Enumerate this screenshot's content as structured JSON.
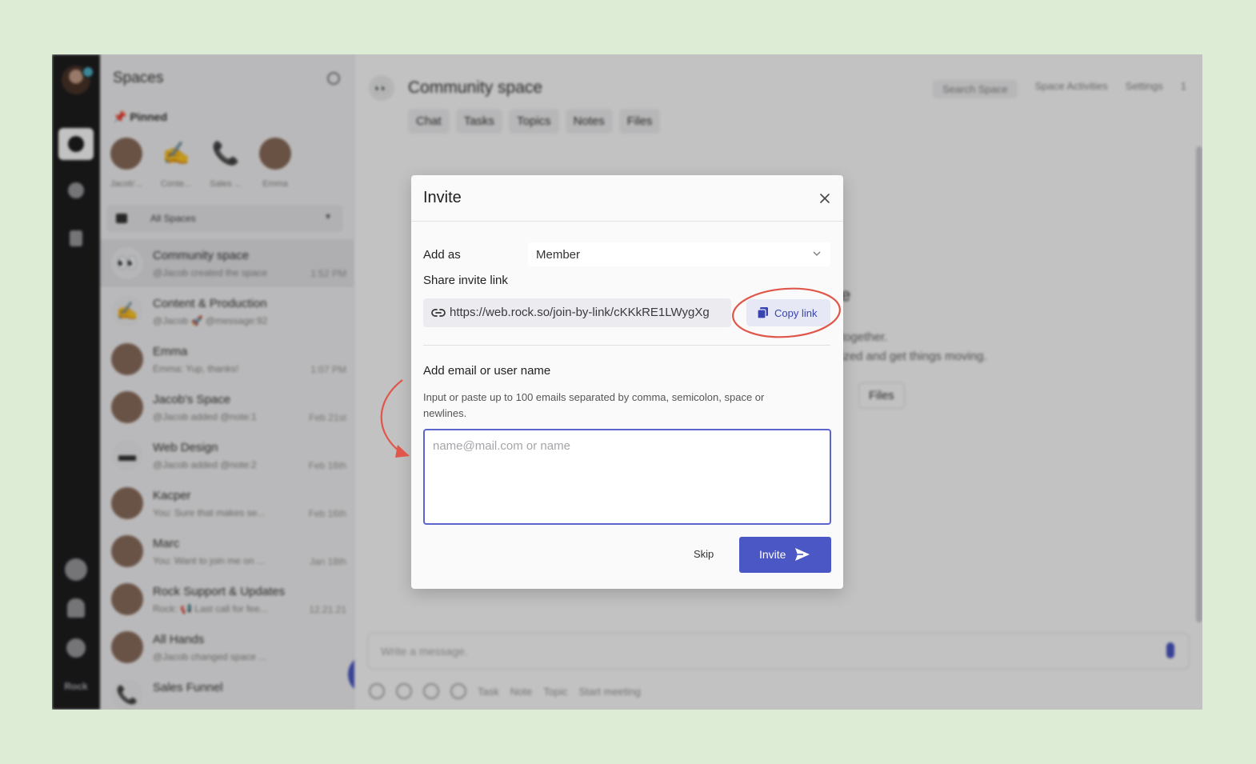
{
  "sidebar": {
    "title": "Spaces",
    "pinned_label": "Pinned",
    "pinned": [
      {
        "label": "Jacob'...",
        "icon": "avatar"
      },
      {
        "label": "Conte...",
        "icon": "writing-hand-emoji"
      },
      {
        "label": "Sales ...",
        "icon": "phone-emoji"
      },
      {
        "label": "Emma",
        "icon": "avatar"
      }
    ],
    "filter": "All Spaces",
    "spaces": [
      {
        "name": "Community space",
        "sub": "@Jacob created the space",
        "time": "1:52 PM",
        "icon": "👀"
      },
      {
        "name": "Content & Production",
        "sub": "@Jacob 🚀 @message:92",
        "time": "",
        "icon": "✍"
      },
      {
        "name": "Emma",
        "sub": "Emma: Yup, thanks!",
        "time": "1:07 PM",
        "icon": ""
      },
      {
        "name": "Jacob's Space",
        "sub": "@Jacob added @note:1",
        "time": "Feb 21st",
        "icon": ""
      },
      {
        "name": "Web Design",
        "sub": "@Jacob added @note:2",
        "time": "Feb 16th",
        "icon": "▬"
      },
      {
        "name": "Kacper",
        "sub": "You: Sure that makes se...",
        "time": "Feb 16th",
        "icon": ""
      },
      {
        "name": "Marc",
        "sub": "You: Want to join me on ...",
        "time": "Jan 18th",
        "icon": ""
      },
      {
        "name": "Rock Support & Updates",
        "sub": "Rock: 📢 Last call for fee...",
        "time": "12.21.21",
        "icon": ""
      },
      {
        "name": "All Hands",
        "sub": "@Jacob changed space ...",
        "time": "",
        "icon": ""
      },
      {
        "name": "Sales Funnel",
        "sub": "",
        "time": "",
        "icon": "📞"
      }
    ],
    "fab_label": "+"
  },
  "rail": {
    "brand": "Rock"
  },
  "main": {
    "title": "Community space",
    "title_icon": "👀",
    "search_label": "Search Space",
    "activities_label": "Space Activities",
    "settings_label": "Settings",
    "members_count": "1",
    "tabs": [
      "Chat",
      "Tasks",
      "Topics",
      "Notes",
      "Files"
    ],
    "empty_title_fragment": "e",
    "empty_line1": "together.",
    "empty_line2": "ized and get things moving.",
    "files_button": "Files",
    "composer_placeholder": "Write a message.",
    "composer_tools": [
      "Task",
      "Note",
      "Topic",
      "Start meeting"
    ]
  },
  "modal": {
    "title": "Invite",
    "add_as_label": "Add as",
    "role_value": "Member",
    "share_label": "Share invite link",
    "invite_url": "https://web.rock.so/join-by-link/cKKkRE1LWygXg",
    "copy_label": "Copy link",
    "email_label": "Add email or user name",
    "help_text": "Input or paste up to 100 emails separated by comma, semicolon, space or newlines.",
    "email_placeholder": "name@mail.com or name",
    "skip_label": "Skip",
    "invite_label": "Invite"
  },
  "colors": {
    "background": "#dcecd5",
    "accent": "#4a57c4",
    "annotation": "#e0564a",
    "rail": "#1d1d1f"
  }
}
